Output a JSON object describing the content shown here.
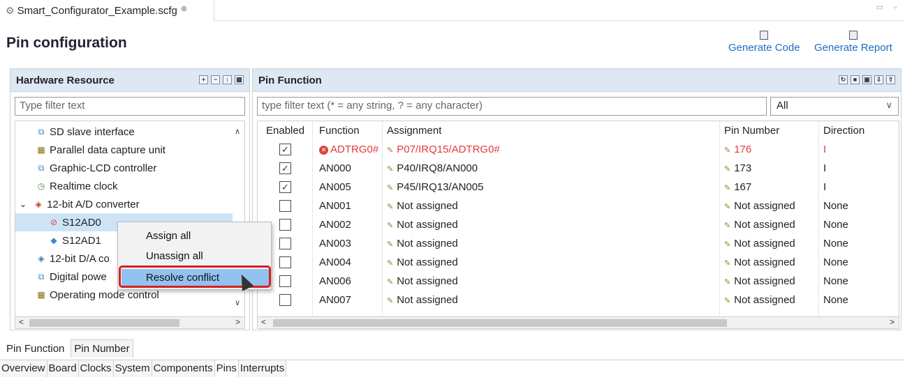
{
  "editor": {
    "tab_label": "Smart_Configurator_Example.scfg",
    "close_glyph": "⊗"
  },
  "page": {
    "title": "Pin configuration"
  },
  "actions": {
    "generate_code": "Generate Code",
    "generate_report": "Generate Report"
  },
  "hardware": {
    "title": "Hardware Resource",
    "filter_placeholder": "Type filter text",
    "items": [
      {
        "label": "SD slave interface",
        "icon": "peripheral-icon",
        "level": 0,
        "expander": ""
      },
      {
        "label": "Parallel data capture unit",
        "icon": "chip-icon",
        "level": 0,
        "expander": ""
      },
      {
        "label": "Graphic-LCD controller",
        "icon": "peripheral-icon",
        "level": 0,
        "expander": ""
      },
      {
        "label": "Realtime clock",
        "icon": "clock-icon",
        "level": 0,
        "expander": ""
      },
      {
        "label": "12-bit A/D converter",
        "icon": "adc-error-icon",
        "level": 0,
        "expander": "⌄"
      },
      {
        "label": "S12AD0",
        "icon": "error-icon",
        "level": 1,
        "expander": ""
      },
      {
        "label": "S12AD1",
        "icon": "unit-icon",
        "level": 1,
        "expander": ""
      },
      {
        "label": "12-bit D/A co",
        "icon": "dac-icon",
        "level": 0,
        "expander": ""
      },
      {
        "label": "Digital powe",
        "icon": "peripheral-icon",
        "level": 0,
        "expander": ""
      },
      {
        "label": "Operating mode control",
        "icon": "chip-icon",
        "level": 0,
        "expander": ""
      }
    ]
  },
  "pin_function": {
    "title": "Pin Function",
    "filter_placeholder": "type filter text (* = any string, ? = any character)",
    "select_value": "All",
    "columns": [
      "Enabled",
      "Function",
      "Assignment",
      "Pin Number",
      "Direction"
    ],
    "rows": [
      {
        "enabled": true,
        "function": "ADTRG0#",
        "assignment": "P07/IRQ15/ADTRG0#",
        "pin": "176",
        "direction": "I",
        "error": true
      },
      {
        "enabled": true,
        "function": "AN000",
        "assignment": "P40/IRQ8/AN000",
        "pin": "173",
        "direction": "I",
        "error": false
      },
      {
        "enabled": true,
        "function": "AN005",
        "assignment": "P45/IRQ13/AN005",
        "pin": "167",
        "direction": "I",
        "error": false
      },
      {
        "enabled": false,
        "function": "AN001",
        "assignment": "Not assigned",
        "pin": "Not assigned",
        "direction": "None",
        "error": false
      },
      {
        "enabled": false,
        "function": "AN002",
        "assignment": "Not assigned",
        "pin": "Not assigned",
        "direction": "None",
        "error": false
      },
      {
        "enabled": false,
        "function": "AN003",
        "assignment": "Not assigned",
        "pin": "Not assigned",
        "direction": "None",
        "error": false
      },
      {
        "enabled": false,
        "function": "AN004",
        "assignment": "Not assigned",
        "pin": "Not assigned",
        "direction": "None",
        "error": false
      },
      {
        "enabled": false,
        "function": "AN006",
        "assignment": "Not assigned",
        "pin": "Not assigned",
        "direction": "None",
        "error": false
      },
      {
        "enabled": false,
        "function": "AN007",
        "assignment": "Not assigned",
        "pin": "Not assigned",
        "direction": "None",
        "error": false
      }
    ]
  },
  "context_menu": {
    "items": [
      "Assign all",
      "Unassign all",
      "Resolve conflict"
    ]
  },
  "view_tabs": [
    "Pin Function",
    "Pin Number"
  ],
  "editor_tabs": [
    "Overview",
    "Board",
    "Clocks",
    "System",
    "Components",
    "Pins",
    "Interrupts"
  ],
  "colors": {
    "accent": "#1a6fc4",
    "error": "#e23b3b",
    "header_bg": "#dee8f4",
    "highlight": "#92c2ef",
    "callout": "#d8201f"
  }
}
